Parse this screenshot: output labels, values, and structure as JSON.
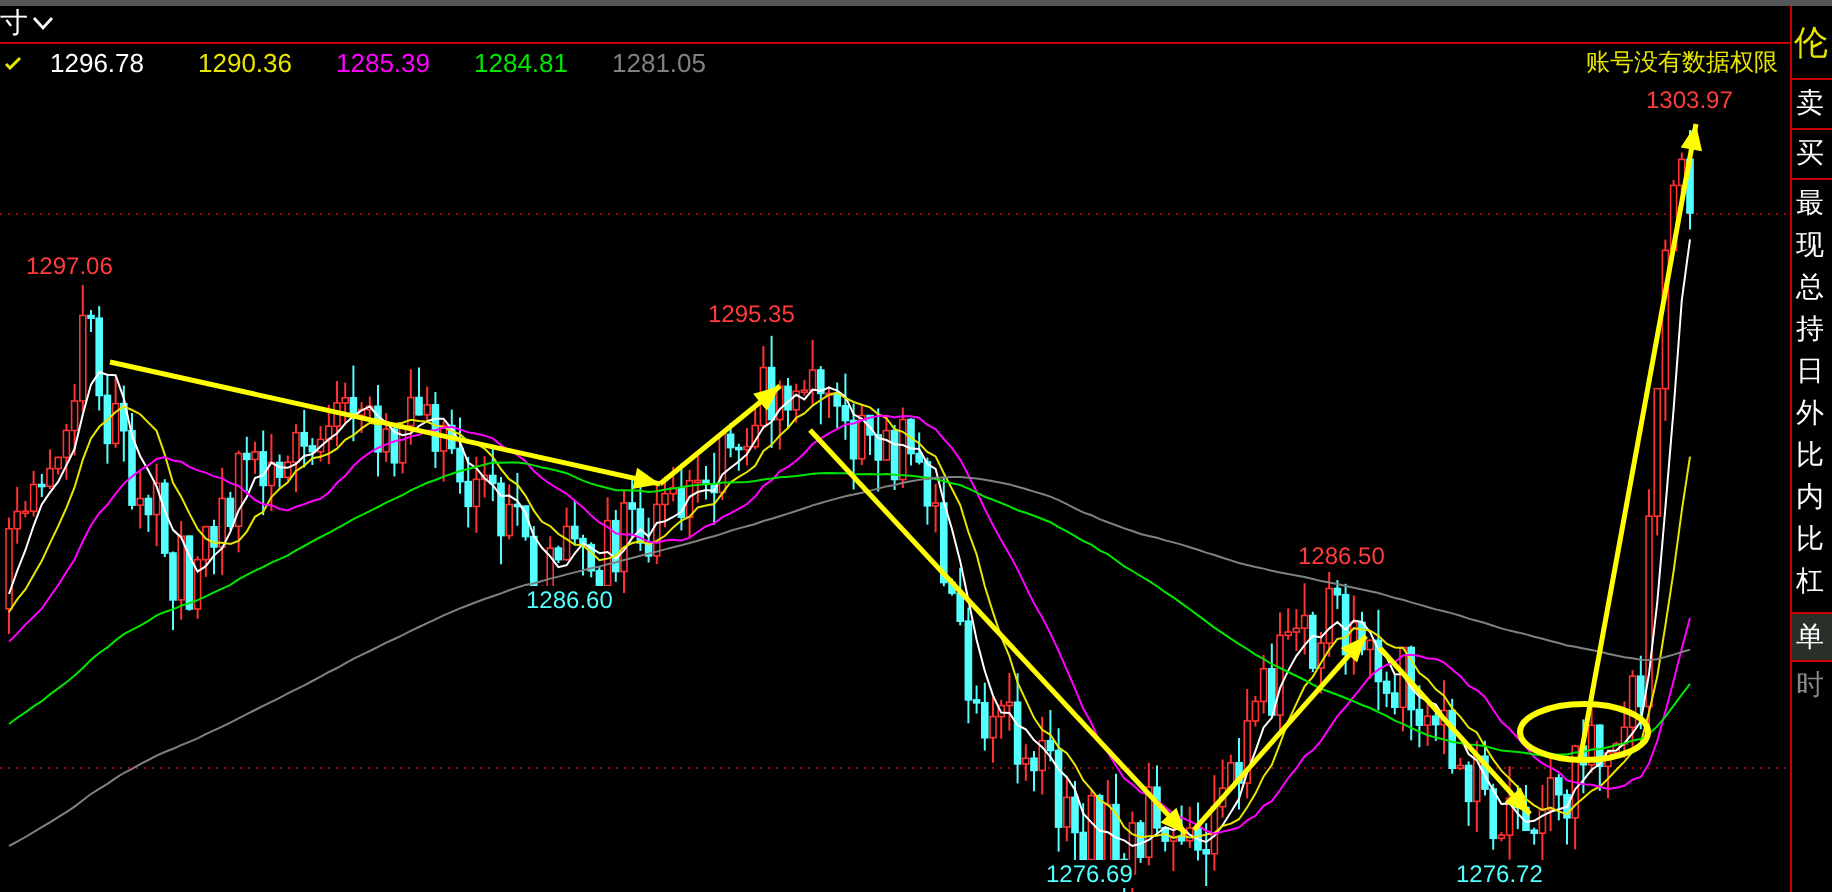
{
  "toolbar": {
    "menu_label": "寸"
  },
  "ma_values": [
    {
      "value": "1296.78",
      "color": "#ffffff"
    },
    {
      "value": "1290.36",
      "color": "#e6e600"
    },
    {
      "value": "1285.39",
      "color": "#ff00ff"
    },
    {
      "value": "1284.81",
      "color": "#00e600"
    },
    {
      "value": "1281.05",
      "color": "#808080"
    }
  ],
  "account_notice": "账号没有数据权限",
  "price_labels": [
    {
      "text": "1297.06",
      "kind": "high"
    },
    {
      "text": "1295.35",
      "kind": "high"
    },
    {
      "text": "1286.60",
      "kind": "low"
    },
    {
      "text": "1286.50",
      "kind": "high"
    },
    {
      "text": "1276.69",
      "kind": "low"
    },
    {
      "text": "1276.72",
      "kind": "low"
    },
    {
      "text": "1303.97",
      "kind": "high"
    }
  ],
  "side_panel": {
    "title": "伦",
    "quotes": [
      {
        "label": "卖"
      },
      {
        "label": "买"
      }
    ],
    "items": [
      {
        "label": "最"
      },
      {
        "label": "现"
      },
      {
        "label": "总"
      },
      {
        "label": "持"
      },
      {
        "label": "日"
      },
      {
        "label": "外"
      },
      {
        "label": "比"
      },
      {
        "label": "内"
      },
      {
        "label": "比"
      },
      {
        "label": "杠"
      }
    ],
    "tabs": [
      {
        "label": "单",
        "selected": true,
        "disabled": false
      },
      {
        "label": "时",
        "selected": false,
        "disabled": true
      }
    ]
  }
}
